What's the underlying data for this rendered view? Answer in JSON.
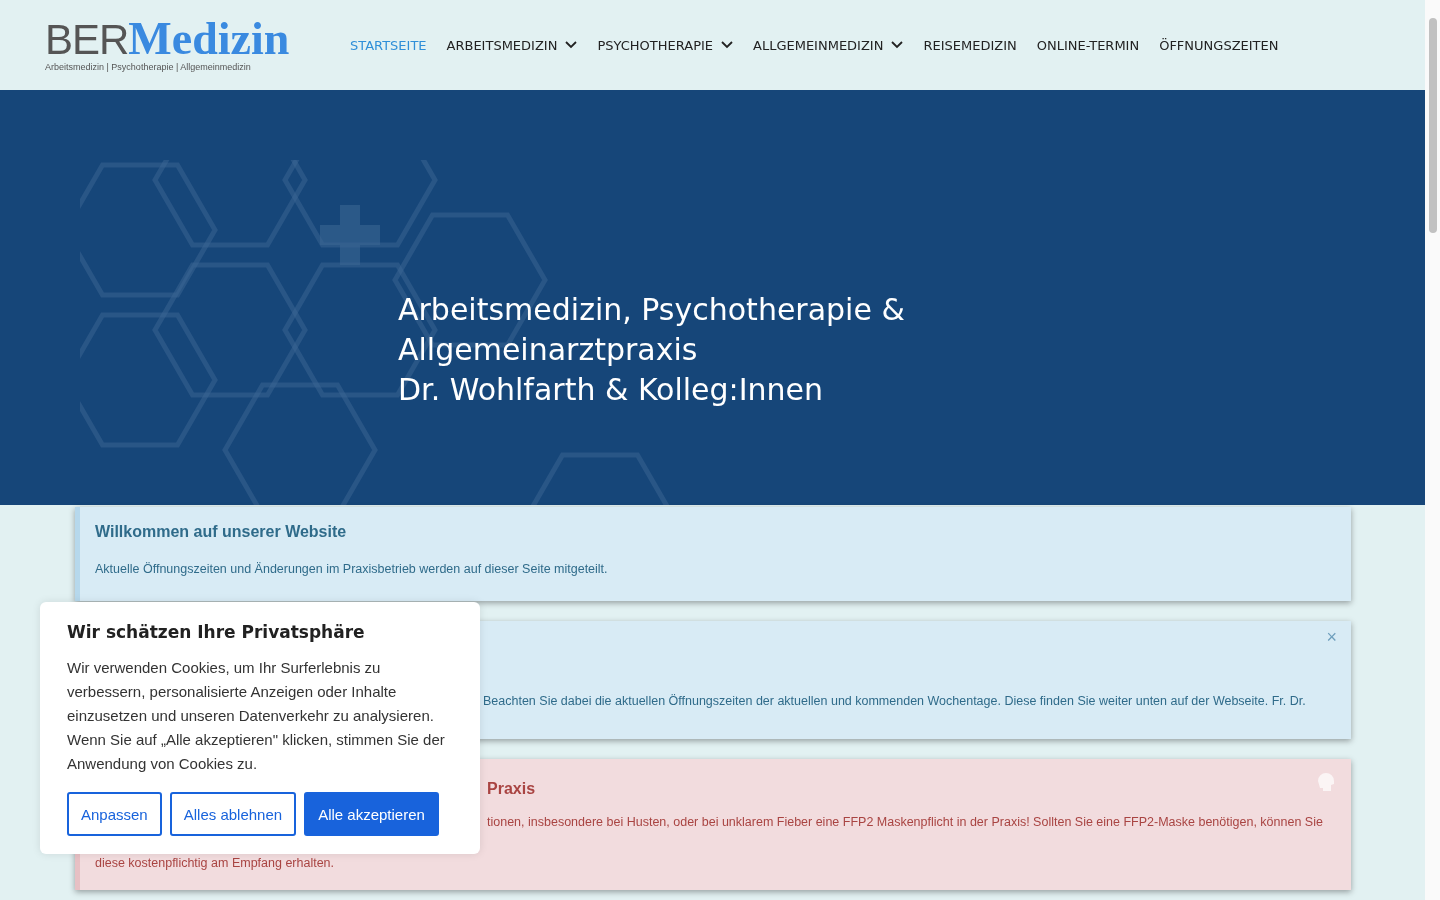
{
  "logo": {
    "brand_dark": "BER",
    "brand_light": "Medizin",
    "tagline": "Arbeitsmedizin | Psychotherapie | Allgemeinmedizin"
  },
  "nav": [
    {
      "label": "STARTSEITE",
      "selected": true,
      "dropdown": false
    },
    {
      "label": "ARBEITSMEDIZIN",
      "selected": false,
      "dropdown": true
    },
    {
      "label": "PSYCHOTHERAPIE",
      "selected": false,
      "dropdown": true
    },
    {
      "label": "ALLGEMEINMEDIZIN",
      "selected": false,
      "dropdown": true
    },
    {
      "label": "REISEMEDIZIN",
      "selected": false,
      "dropdown": false
    },
    {
      "label": "ONLINE-TERMIN",
      "selected": false,
      "dropdown": false
    },
    {
      "label": "ÖFFNUNGSZEITEN",
      "selected": false,
      "dropdown": false
    }
  ],
  "hero": {
    "lines": [
      "Arbeitsmedizin, Psychotherapie &",
      "Allgemeinarztpraxis",
      "Dr. Wohlfarth & Kolleg:Innen"
    ]
  },
  "notices": [
    {
      "kind": "info",
      "title": "Willkommen auf unserer Website",
      "text": "Aktuelle Öffnungszeiten und Änderungen im Praxisbetrieb werden auf dieser Seite mitgeteilt.",
      "covered": false,
      "icon": false
    },
    {
      "kind": "info",
      "text": "Beachten Sie dabei die aktuellen Öffnungszeiten der aktuellen und kommenden Wochentage. Diese finden Sie weiter unten auf der Webseite. Fr. Dr.",
      "covered": true,
      "close_label": "×",
      "icon": false
    },
    {
      "kind": "danger",
      "title": "Praxis",
      "text": "tionen, insbesondere bei Husten, oder bei unklarem Fieber eine FFP2 Maskenpflicht in der Praxis! Sollten Sie eine FFP2-Maske benötigen, können Sie",
      "text_2": "diese kostenpflichtig am Empfang erhalten.",
      "covered": true,
      "icon": true
    }
  ],
  "cookie": {
    "title": "Wir schätzen Ihre Privatsphäre",
    "text": "Wir verwenden Cookies, um Ihr Surferlebnis zu verbessern, personalisierte Anzeigen oder Inhalte einzusetzen und unseren Datenverkehr zu analysieren. Wenn Sie auf „Alle akzeptieren\" klicken, stimmen Sie der Anwendung von Cookies zu.",
    "buttons": [
      {
        "label": "Anpassen",
        "kind": "outline"
      },
      {
        "label": "Alles ablehnen",
        "kind": "outline"
      },
      {
        "label": "Alle akzeptieren",
        "kind": "primary"
      }
    ]
  }
}
